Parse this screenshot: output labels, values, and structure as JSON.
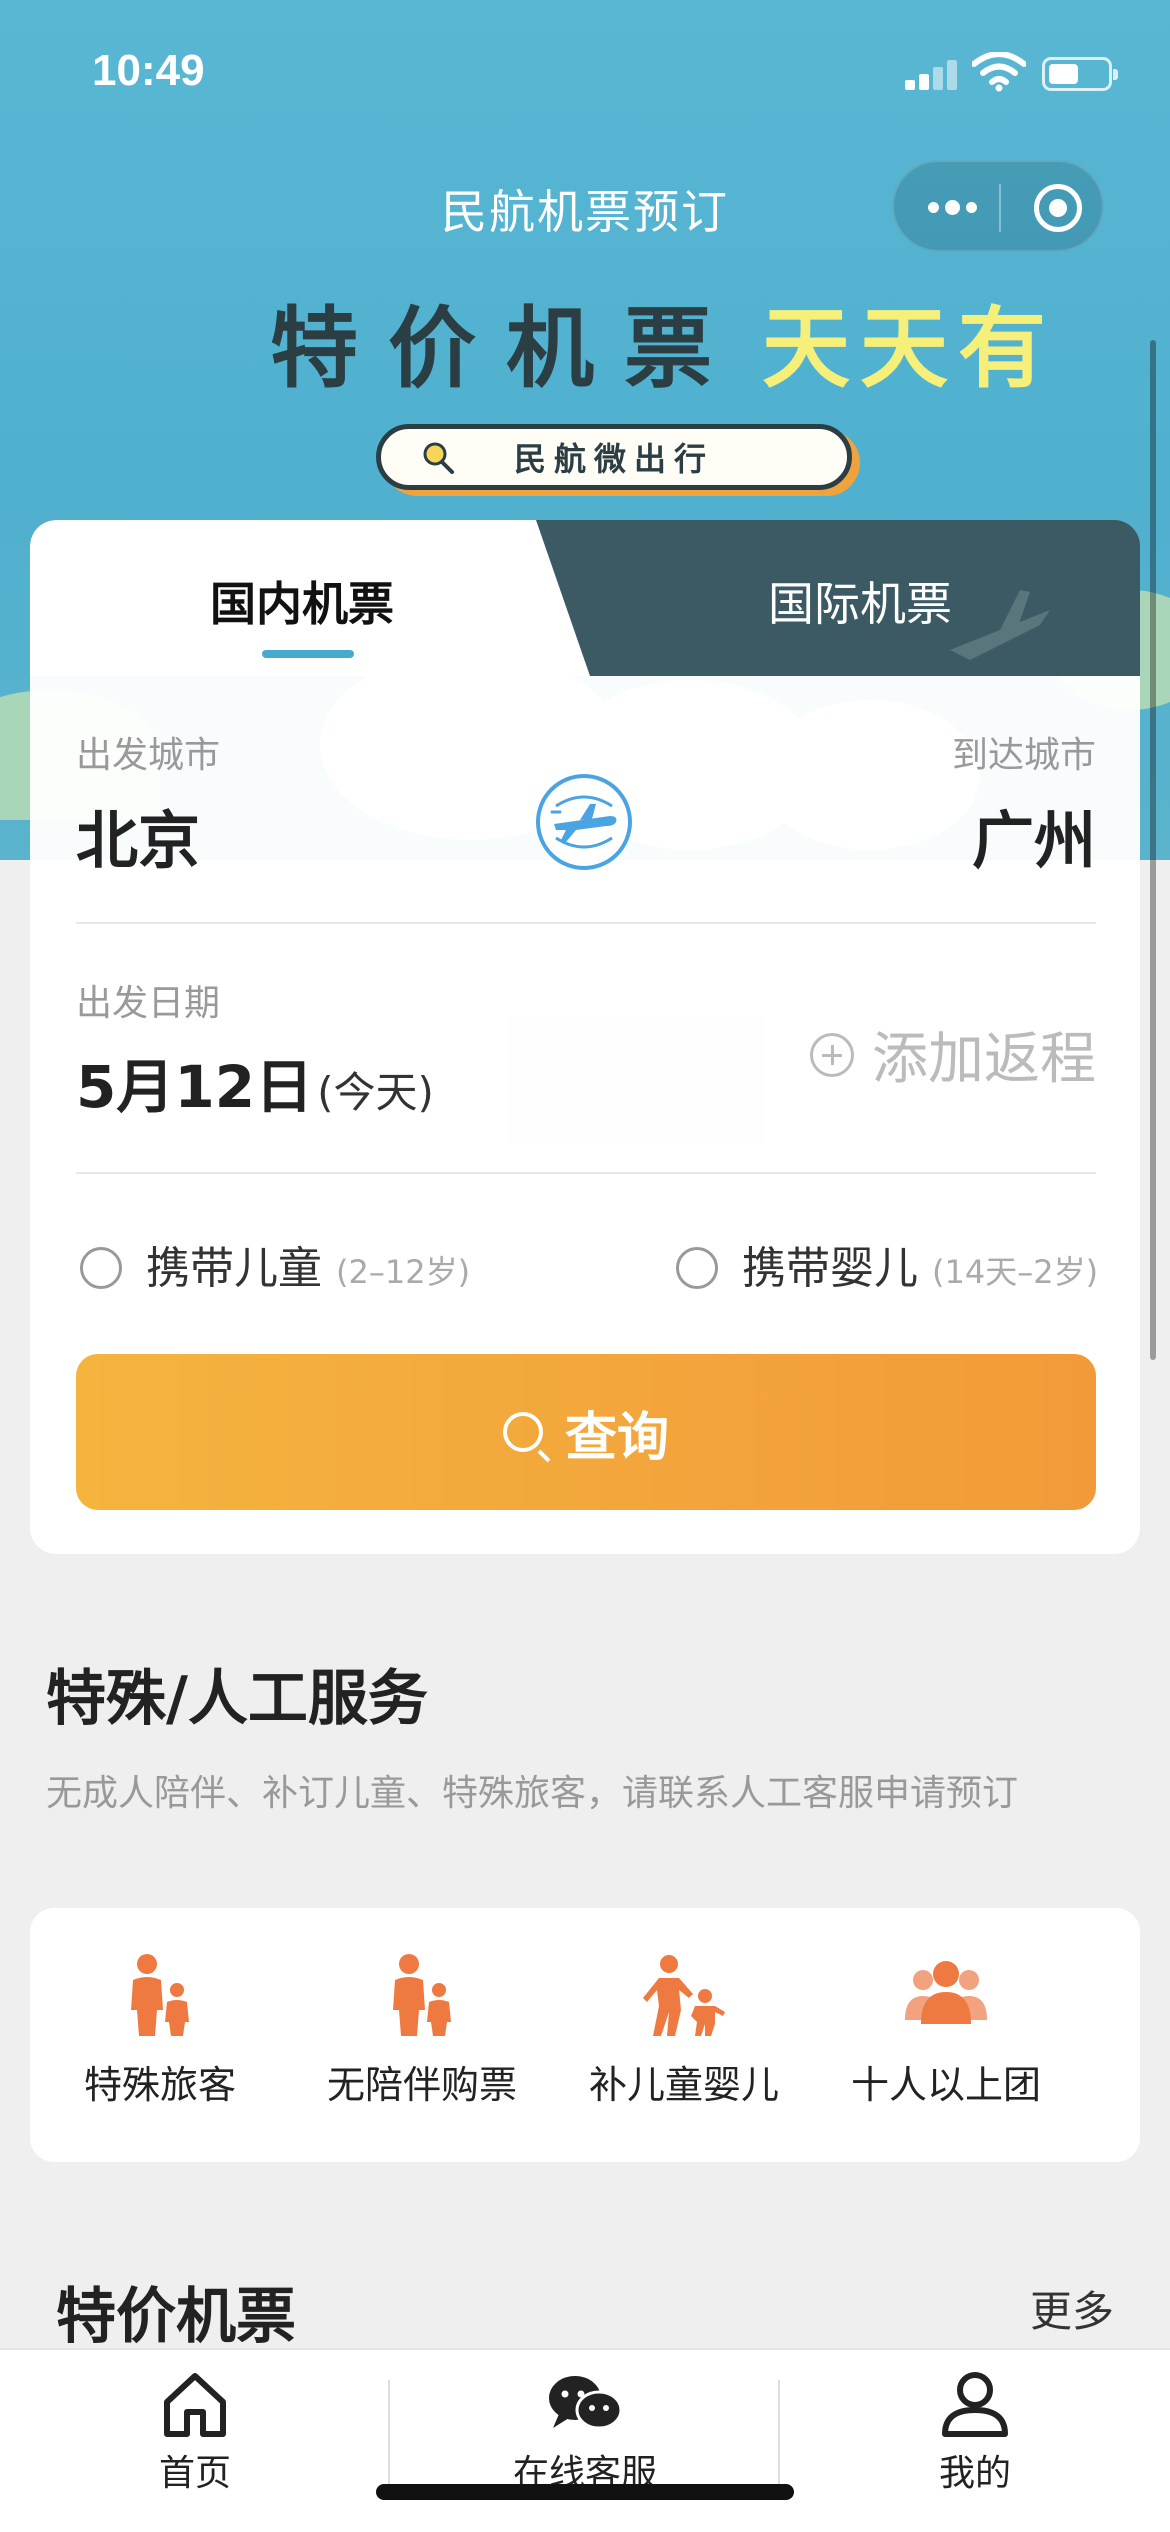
{
  "status_bar": {
    "time": "10:49",
    "battery_level": 0.45
  },
  "nav": {
    "title": "民航机票预订"
  },
  "banner": {
    "title_main": "特价机票",
    "title_highlight": "天天有",
    "badge": "民航微出行"
  },
  "tabs": [
    {
      "label": "国内机票",
      "active": true
    },
    {
      "label": "国际机票",
      "active": false
    }
  ],
  "search": {
    "from_label": "出发城市",
    "from_city": "北京",
    "to_label": "到达城市",
    "to_city": "广州",
    "date_label": "出发日期",
    "date_value": "5月12日",
    "date_note": "(今天)",
    "add_return": "添加返程",
    "child_option": {
      "label": "携带儿童",
      "hint": "(2–12岁)"
    },
    "infant_option": {
      "label": "携带婴儿",
      "hint": "(14天–2岁)"
    },
    "query_button": "查询"
  },
  "special_services": {
    "title": "特殊/人工服务",
    "description": "无成人陪伴、补订儿童、特殊旅客，请联系人工客服申请预订",
    "items": [
      {
        "label": "特殊旅客",
        "icon": "special-passenger-icon"
      },
      {
        "label": "无陪伴购票",
        "icon": "unaccompanied-icon"
      },
      {
        "label": "补儿童婴儿",
        "icon": "child-infant-icon"
      },
      {
        "label": "十人以上团",
        "icon": "group-icon"
      }
    ]
  },
  "deals": {
    "title": "特价机票",
    "more": "更多"
  },
  "tabbar": [
    {
      "label": "首页",
      "icon": "home-icon"
    },
    {
      "label": "在线客服",
      "icon": "chat-icon"
    },
    {
      "label": "我的",
      "icon": "user-icon"
    }
  ],
  "colors": {
    "header_blue": "#59b7d3",
    "accent_orange": "#f29a3a",
    "icon_orange": "#ee7a42",
    "tab_active_underline": "#46a9d0"
  }
}
